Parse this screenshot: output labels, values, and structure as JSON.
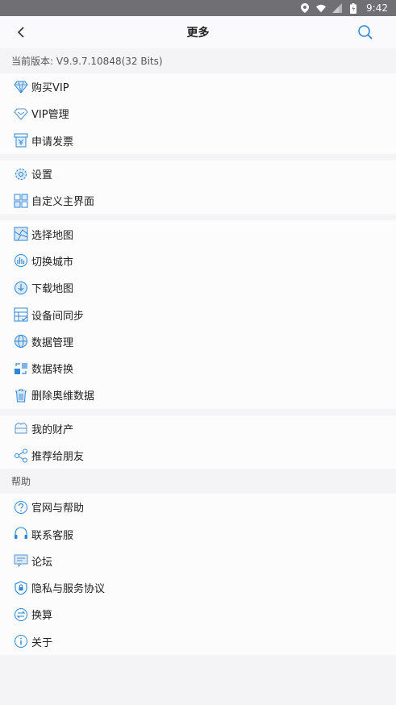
{
  "status_bar": {
    "time": "9:42"
  },
  "header": {
    "title": "更多"
  },
  "version_label": "当前版本: V9.9.7.10848(32 Bits)",
  "groups": [
    {
      "items": [
        {
          "label": "购买VIP",
          "icon": "diamond-icon"
        },
        {
          "label": "VIP管理",
          "icon": "vip-manage-icon"
        },
        {
          "label": "申请发票",
          "icon": "invoice-icon"
        }
      ]
    },
    {
      "items": [
        {
          "label": "设置",
          "icon": "gear-icon"
        },
        {
          "label": "自定义主界面",
          "icon": "grid-icon"
        }
      ]
    },
    {
      "items": [
        {
          "label": "选择地图",
          "icon": "map-icon"
        },
        {
          "label": "切换城市",
          "icon": "city-icon"
        },
        {
          "label": "下载地图",
          "icon": "download-icon"
        },
        {
          "label": "设备间同步",
          "icon": "sync-icon"
        },
        {
          "label": "数据管理",
          "icon": "globe-icon"
        },
        {
          "label": "数据转换",
          "icon": "convert-icon"
        },
        {
          "label": "删除奥维数据",
          "icon": "trash-icon"
        }
      ]
    },
    {
      "items": [
        {
          "label": "我的财产",
          "icon": "wallet-icon"
        },
        {
          "label": "推荐给朋友",
          "icon": "share-icon"
        }
      ]
    }
  ],
  "help_label": "帮助",
  "help_items": [
    {
      "label": "官网与帮助",
      "icon": "question-icon"
    },
    {
      "label": "联系客服",
      "icon": "headset-icon"
    },
    {
      "label": "论坛",
      "icon": "forum-icon"
    },
    {
      "label": "隐私与服务协议",
      "icon": "shield-icon"
    },
    {
      "label": "换算",
      "icon": "exchange-icon"
    },
    {
      "label": "关于",
      "icon": "info-icon"
    }
  ]
}
